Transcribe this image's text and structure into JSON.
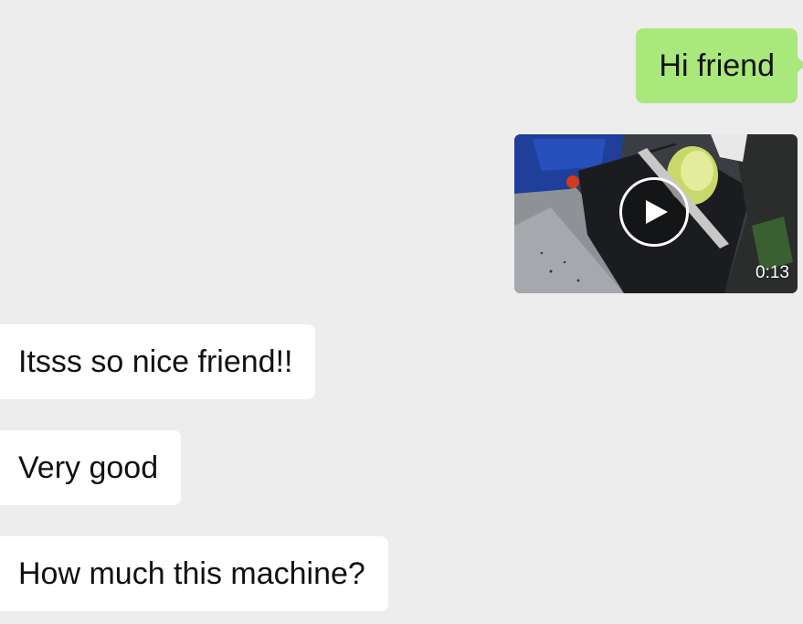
{
  "colors": {
    "background": "#ededed",
    "outgoing_bubble": "#a9e87b",
    "incoming_bubble": "#ffffff",
    "text": "#111111"
  },
  "messages": {
    "hi_friend": "Hi friend",
    "video": {
      "duration": "0:13",
      "play_icon": "play-icon"
    },
    "nice": "Itsss so nice friend!!",
    "very_good": "Very good",
    "how_much": "How much this machine?"
  }
}
